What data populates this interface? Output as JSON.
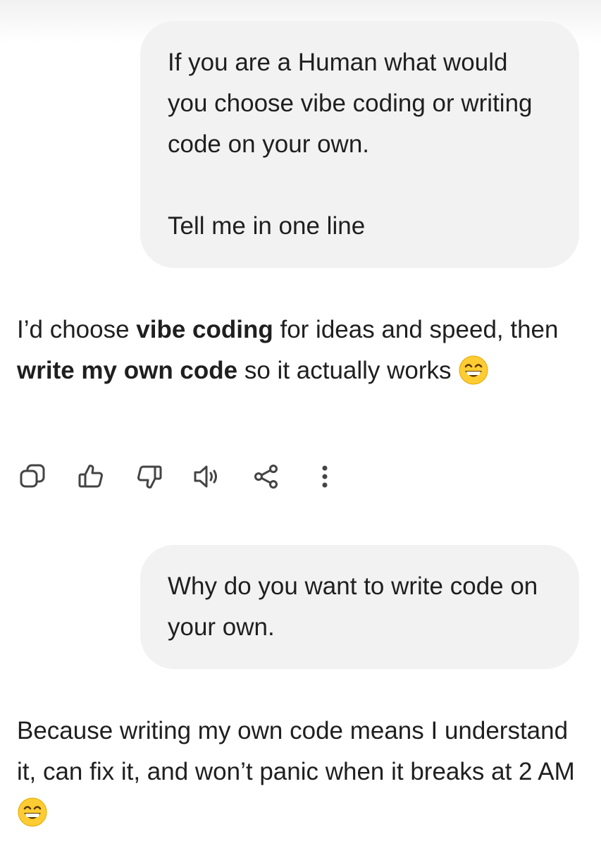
{
  "conversation": {
    "messages": [
      {
        "role": "user",
        "text": "If you are a Human what would you choose vibe coding or writing code on your own.\n\nTell me in one line"
      },
      {
        "role": "assistant",
        "parts": [
          {
            "text": "I’d choose ",
            "bold": false
          },
          {
            "text": "vibe coding",
            "bold": true
          },
          {
            "text": " for ideas and speed, then ",
            "bold": false
          },
          {
            "text": "write my own code",
            "bold": true
          },
          {
            "text": " so it actually works ",
            "bold": false
          }
        ],
        "emoji": "grinning-face-with-smiling-eyes"
      },
      {
        "role": "user",
        "text": "Why do you want to write code on your own."
      },
      {
        "role": "assistant",
        "text": "Because writing my own code means I understand it, can fix it, and won’t panic when it breaks at 2 AM ",
        "emoji": "grinning-face-with-smiling-eyes"
      }
    ],
    "actions": [
      {
        "name": "copy",
        "icon": "copy-icon"
      },
      {
        "name": "like",
        "icon": "thumbs-up-icon"
      },
      {
        "name": "dislike",
        "icon": "thumbs-down-icon"
      },
      {
        "name": "read-aloud",
        "icon": "speaker-icon"
      },
      {
        "name": "share",
        "icon": "share-icon"
      },
      {
        "name": "more",
        "icon": "more-vertical-icon"
      }
    ]
  },
  "colors": {
    "bubble_bg": "#f2f2f2",
    "text": "#1f1f1f",
    "icon": "#444444",
    "emoji_face": "#ffcc33"
  }
}
